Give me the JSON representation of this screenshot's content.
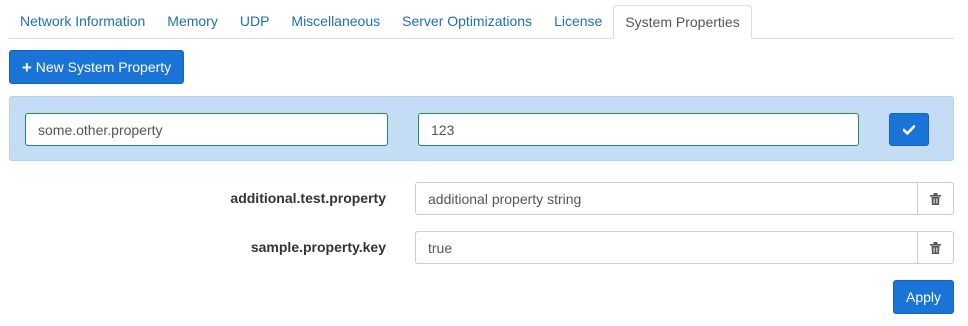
{
  "tabs": [
    {
      "label": "Network Information",
      "active": false
    },
    {
      "label": "Memory",
      "active": false
    },
    {
      "label": "UDP",
      "active": false
    },
    {
      "label": "Miscellaneous",
      "active": false
    },
    {
      "label": "Server Optimizations",
      "active": false
    },
    {
      "label": "License",
      "active": false
    },
    {
      "label": "System Properties",
      "active": true
    }
  ],
  "toolbar": {
    "new_property_label": "New System Property",
    "new_property_icon": "plus-icon"
  },
  "new_property": {
    "key_value": "some.other.property",
    "value_value": "123",
    "confirm_icon": "check-icon"
  },
  "properties": [
    {
      "key": "additional.test.property",
      "value": "additional property string",
      "delete_icon": "trash-icon"
    },
    {
      "key": "sample.property.key",
      "value": "true",
      "delete_icon": "trash-icon"
    }
  ],
  "actions": {
    "apply_label": "Apply"
  },
  "colors": {
    "accent": "#1a73d6",
    "tab_link": "#1f6fb4",
    "panel_background": "#c4ddf4",
    "valid_border": "#1f8a5b"
  }
}
